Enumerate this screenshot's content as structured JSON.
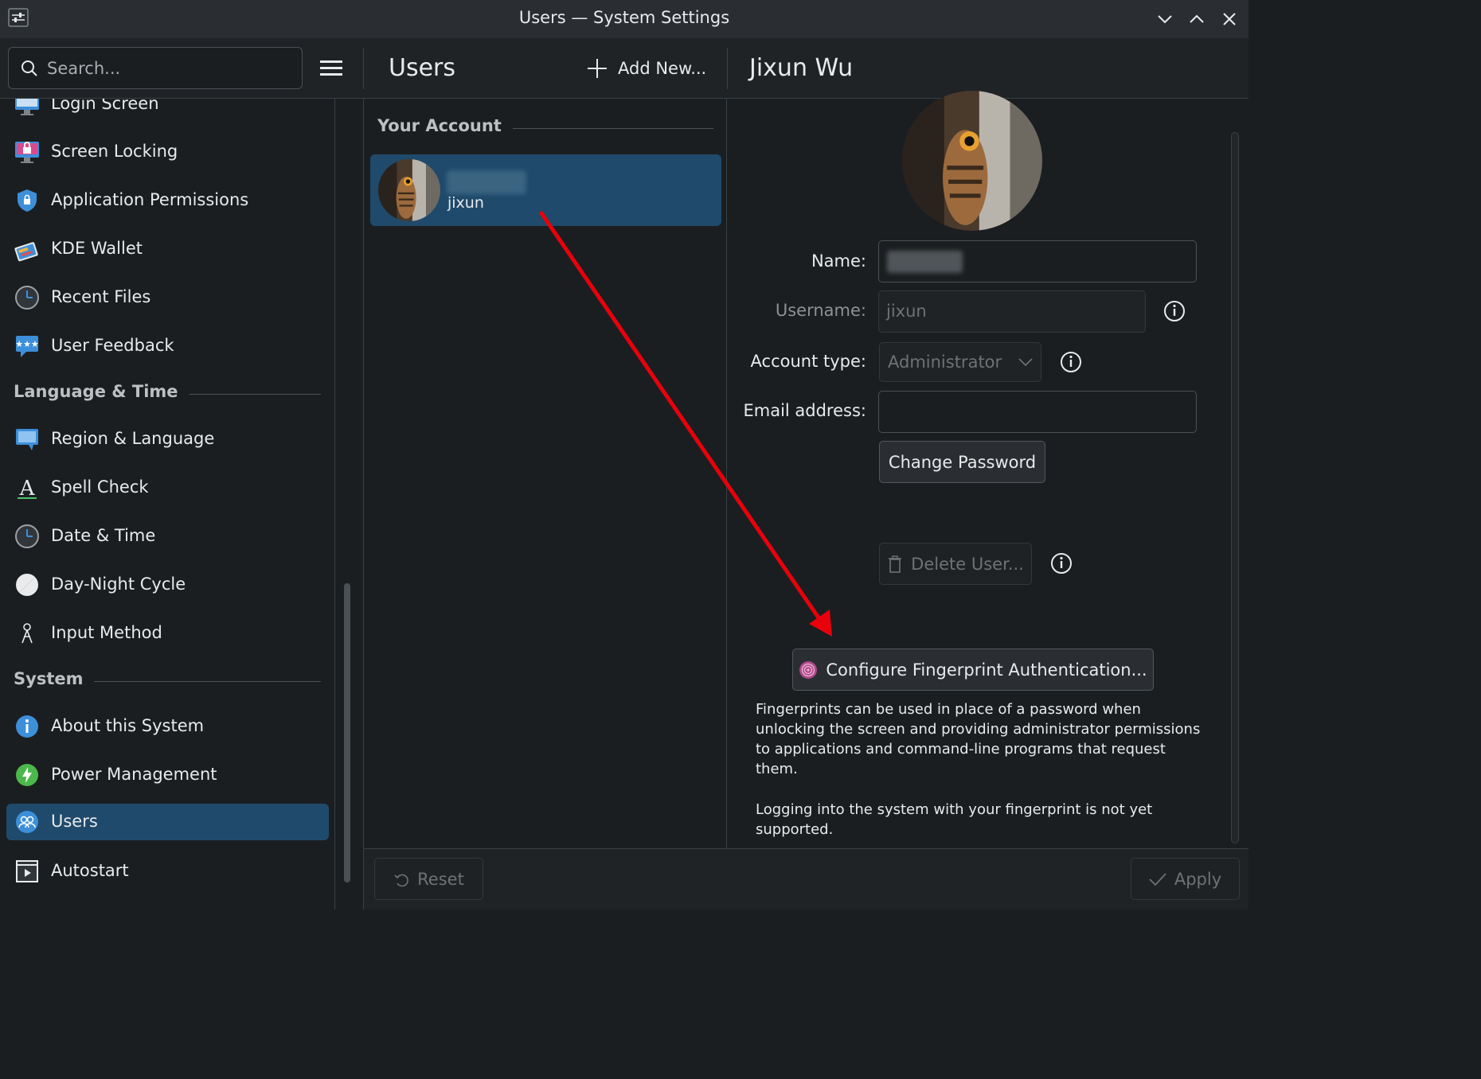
{
  "window": {
    "title": "Users — System Settings"
  },
  "header": {
    "search_placeholder": "Search...",
    "module_title": "Users",
    "add_new_label": "Add New...",
    "detail_title": "Jixun Wu"
  },
  "sidebar": {
    "items_top": [
      {
        "label": "Login Screen",
        "icon": "login-screen-icon"
      },
      {
        "label": "Screen Locking",
        "icon": "screen-locking-icon"
      },
      {
        "label": "Application Permissions",
        "icon": "shield-icon"
      },
      {
        "label": "KDE Wallet",
        "icon": "wallet-icon"
      },
      {
        "label": "Recent Files",
        "icon": "clock-icon"
      },
      {
        "label": "User Feedback",
        "icon": "feedback-icon"
      }
    ],
    "category_language": "Language & Time",
    "items_language": [
      {
        "label": "Region & Language",
        "icon": "region-icon"
      },
      {
        "label": "Spell Check",
        "icon": "spell-check-icon"
      },
      {
        "label": "Date & Time",
        "icon": "clock-icon"
      },
      {
        "label": "Day-Night Cycle",
        "icon": "day-night-icon"
      },
      {
        "label": "Input Method",
        "icon": "input-method-icon"
      }
    ],
    "category_system": "System",
    "items_system": [
      {
        "label": "About this System",
        "icon": "info-icon"
      },
      {
        "label": "Power Management",
        "icon": "power-icon"
      },
      {
        "label": "Users",
        "icon": "users-icon",
        "selected": true
      },
      {
        "label": "Autostart",
        "icon": "autostart-icon"
      }
    ]
  },
  "accounts": {
    "section_label": "Your Account",
    "current": {
      "username": "jixun"
    }
  },
  "form": {
    "name_label": "Name:",
    "username_label": "Username:",
    "username_value": "jixun",
    "account_type_label": "Account type:",
    "account_type_value": "Administrator",
    "email_label": "Email address:",
    "email_value": "",
    "change_password_label": "Change Password",
    "delete_user_label": "Delete User...",
    "fingerprint_button_label": "Configure Fingerprint Authentication...",
    "fingerprint_description": "Fingerprints can be used in place of a password when unlocking the screen and providing administrator permissions to applications and command-line programs that request them.",
    "fingerprint_note": "Logging into the system with your fingerprint is not yet supported."
  },
  "footer": {
    "reset_label": "Reset",
    "apply_label": "Apply"
  },
  "colors": {
    "accent": "#1f4a6b",
    "background": "#1b1e20",
    "annotation_arrow": "#e8000b"
  }
}
